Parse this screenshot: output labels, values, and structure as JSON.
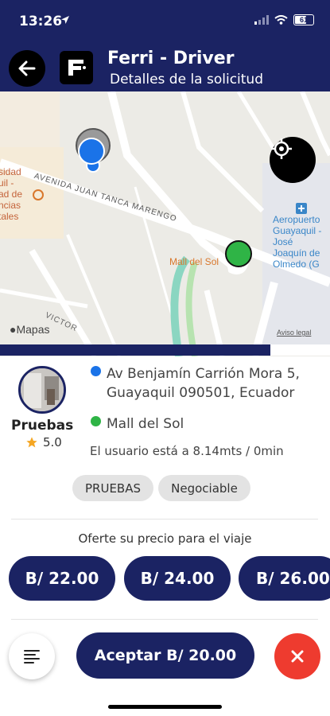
{
  "status_bar": {
    "time": "13:26",
    "battery": "61"
  },
  "header": {
    "title": "Ferri - Driver",
    "subtitle": "Detalles de la solicitud"
  },
  "map": {
    "labels": {
      "street_1": "AVENIDA JUAN TANCA MARENGO",
      "place_1_lines": [
        "sidad",
        "uil -",
        "ad de",
        "ncias",
        "tales"
      ],
      "mall": "Mall del Sol",
      "airport_lines": [
        "Aeropuerto",
        "Guayaquil - José",
        "Joaquín de",
        "Olmedo (G"
      ],
      "street_2": "VICTOR",
      "maps_brand": "Mapas",
      "legal": "Aviso legal"
    }
  },
  "progress": {
    "fraction": 0.82
  },
  "passenger": {
    "name": "Pruebas",
    "rating": "5.0",
    "origin": "Av Benjamín Carrión Mora 5, Guayaquil 090501, Ecuador",
    "destination": "Mall del Sol",
    "distance_text": "El usuario está a 8.14mts / 0min"
  },
  "tags": [
    "PRUEBAS",
    "Negociable"
  ],
  "offer": {
    "title": "Oferte su precio para el viaje",
    "prices": [
      "B/ 22.00",
      "B/ 24.00",
      "B/ 26.00"
    ]
  },
  "actions": {
    "accept_label": "Aceptar B/ 20.00"
  },
  "colors": {
    "primary": "#1b2363",
    "origin_dot": "#1a73e8",
    "destination_dot": "#2fb446",
    "cancel": "#ee3b2f",
    "star": "#f5a623"
  },
  "icons": {
    "back": "arrow-left-icon",
    "logo": "ferri-logo",
    "locate": "crosshair-icon",
    "menu": "menu-lines-icon",
    "cancel": "close-icon"
  }
}
